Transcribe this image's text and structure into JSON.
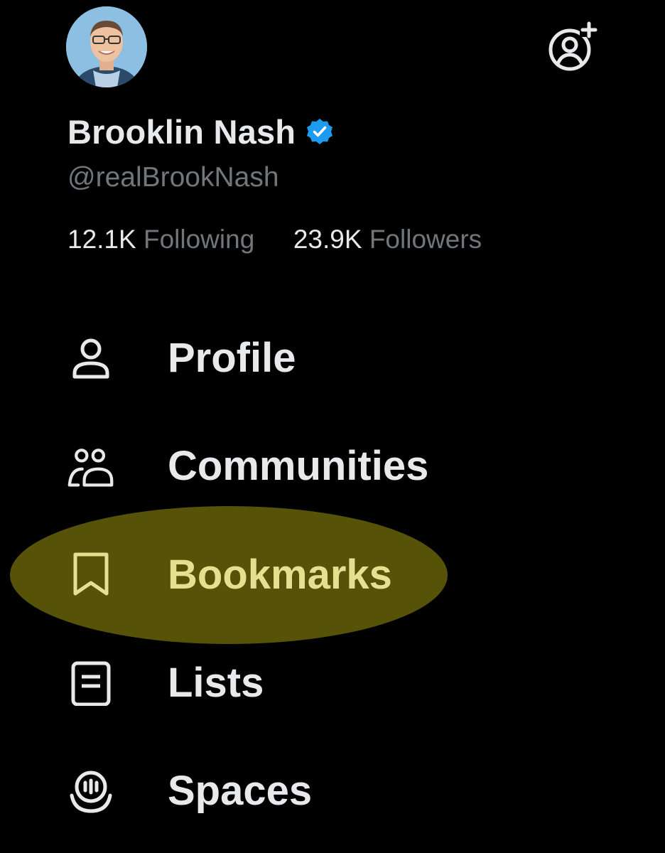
{
  "profile": {
    "display_name": "Brooklin Nash",
    "handle": "@realBrookNash",
    "following_count": "12.1K",
    "following_label": "Following",
    "followers_count": "23.9K",
    "followers_label": "Followers",
    "verified": true
  },
  "header": {
    "add_account_icon": "add-account-icon"
  },
  "menu": {
    "items": [
      {
        "label": "Profile",
        "icon": "person-icon"
      },
      {
        "label": "Communities",
        "icon": "communities-icon"
      },
      {
        "label": "Bookmarks",
        "icon": "bookmark-icon",
        "highlighted": true
      },
      {
        "label": "Lists",
        "icon": "lists-icon"
      },
      {
        "label": "Spaces",
        "icon": "spaces-icon"
      }
    ]
  },
  "colors": {
    "background": "#000000",
    "primary_text": "#e7e9ea",
    "secondary_text": "#71767b",
    "verified_blue": "#1d9bf0",
    "highlight_fill": "#565208",
    "highlight_text": "#e3e08f"
  }
}
